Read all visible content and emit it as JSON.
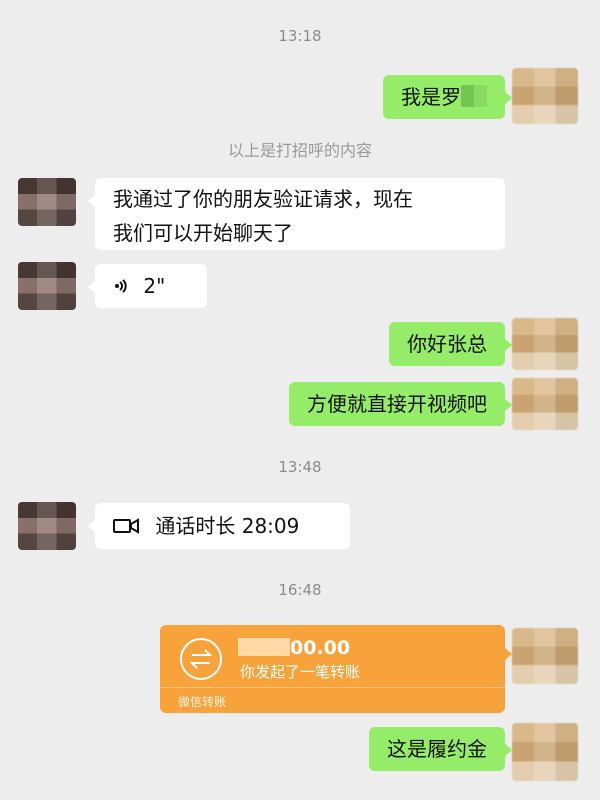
{
  "timestamps": [
    "13:18",
    "13:48",
    "16:48"
  ],
  "system_note": "以上是打招呼的内容",
  "messages": {
    "m1": "我是罗",
    "m2_line1": "我通过了你的朋友验证请求，现在",
    "m2_line2": "我们可以开始聊天了",
    "m3_voice_duration": "2\"",
    "m4": "你好张总",
    "m5": "方便就直接开视频吧",
    "m6_call": "通话时长 28:09",
    "m7_amount": "00.00",
    "m7_desc": "你发起了一笔转账",
    "m7_footer": "微信转账",
    "m8": "这是履约金"
  },
  "icons": {
    "voice": "voice-icon",
    "video": "video-call-icon",
    "transfer": "transfer-icon"
  },
  "colors": {
    "background": "#ededed",
    "green_bubble": "#95ec69",
    "white_bubble": "#ffffff",
    "transfer_orange": "#f7a23b"
  }
}
